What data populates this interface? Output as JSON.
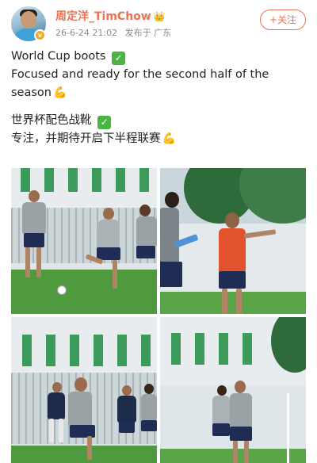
{
  "post": {
    "username": "周定洋_TimChow",
    "date": "26-6-24 21:02",
    "location": "发布于 广东",
    "follow_label": "+关注"
  },
  "content": {
    "line1": "World Cup boots",
    "line2": "Focused and ready for the second half of the season",
    "line3": "世界杯配色战靴",
    "line4": "专注，并期待开启下半程联赛"
  },
  "icons": {
    "check": "✓",
    "bicep": "💪",
    "crown": "👑",
    "verified": "v"
  },
  "colors": {
    "username": "#eb7350",
    "meta": "#8b8b8b",
    "follow": "#eb7350"
  },
  "photos": [
    {
      "name": "training-photo-1"
    },
    {
      "name": "training-photo-2"
    },
    {
      "name": "training-photo-3"
    },
    {
      "name": "training-photo-4"
    }
  ]
}
